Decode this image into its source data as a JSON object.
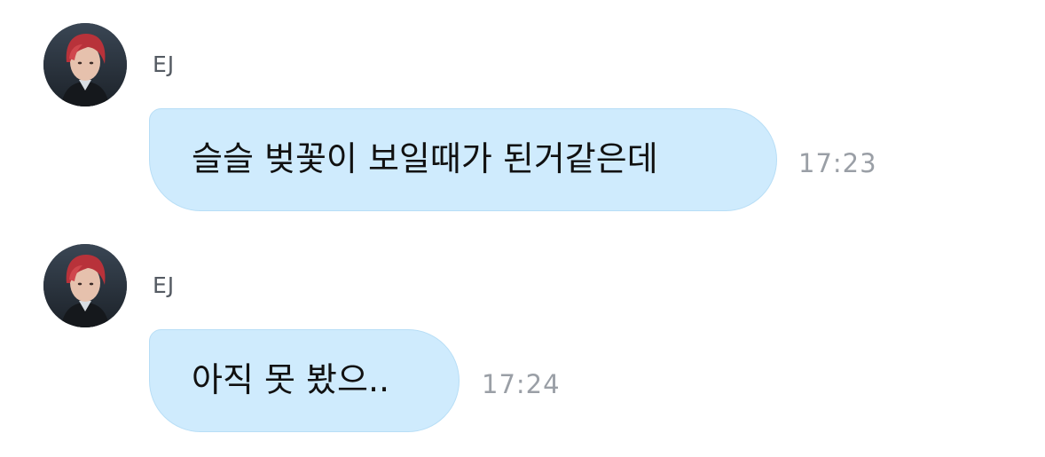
{
  "messages": [
    {
      "sender": "EJ",
      "avatar": "profile-photo",
      "text": "슬슬 벚꽃이 보일때가 된거같은데",
      "time": "17:23"
    },
    {
      "sender": "EJ",
      "avatar": "profile-photo",
      "text": "아직 못 봤으..",
      "time": "17:24"
    }
  ],
  "colors": {
    "bubble_fill": "#cfebfd",
    "bubble_border": "#b8def6",
    "sender_text": "#555b63",
    "time_text": "#9a9fa6",
    "message_text": "#111111",
    "avatar_hair": "#b8323a"
  }
}
